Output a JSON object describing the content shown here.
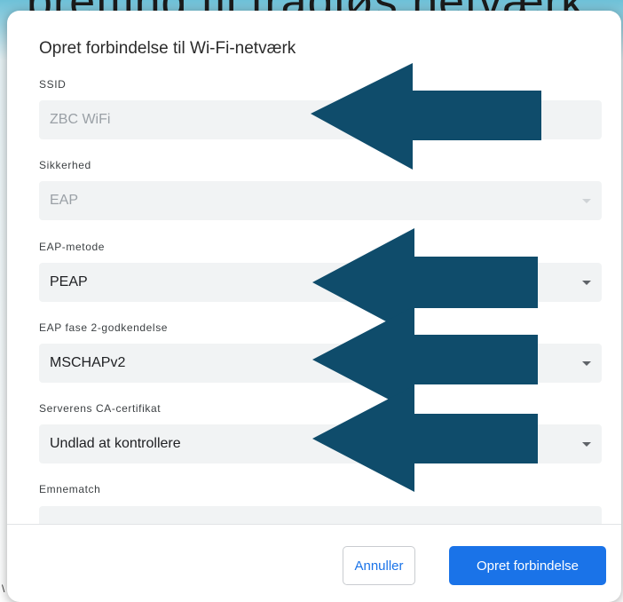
{
  "background_text": "pretting til trådløs netværk",
  "stray_char": "\\",
  "dialog": {
    "title": "Opret forbindelse til Wi-Fi-netværk",
    "fields": [
      {
        "label": "SSID",
        "value": "ZBC WiFi",
        "disabled": true,
        "dropdown": false
      },
      {
        "label": "Sikkerhed",
        "value": "EAP",
        "disabled": true,
        "dropdown": true
      },
      {
        "label": "EAP-metode",
        "value": "PEAP",
        "disabled": false,
        "dropdown": true
      },
      {
        "label": "EAP fase 2-godkendelse",
        "value": "MSCHAPv2",
        "disabled": false,
        "dropdown": true
      },
      {
        "label": "Serverens CA-certifikat",
        "value": "Undlad at kontrollere",
        "disabled": false,
        "dropdown": true
      },
      {
        "label": "Emnematch",
        "value": "",
        "disabled": false,
        "dropdown": false
      }
    ],
    "buttons": {
      "cancel": "Annuller",
      "connect": "Opret forbindelse"
    }
  },
  "colors": {
    "accent": "#1a73e8",
    "arrow": "#0f4c6b",
    "field_bg": "#f1f3f4"
  },
  "annotations": {
    "arrow_count": 4,
    "arrow_direction": "left",
    "points_at": [
      "SSID",
      "EAP-metode",
      "EAP fase 2-godkendelse",
      "Serverens CA-certifikat"
    ]
  }
}
